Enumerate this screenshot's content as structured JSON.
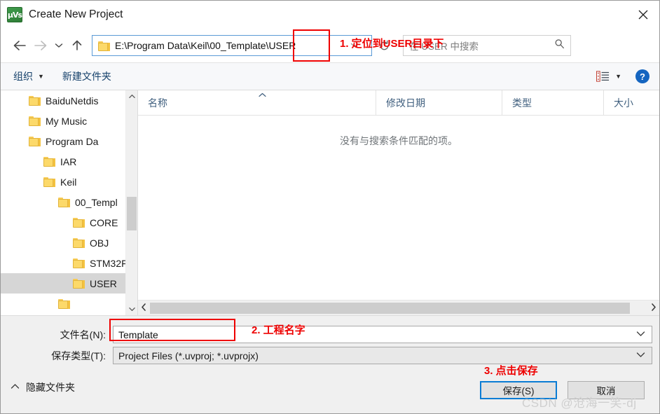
{
  "window": {
    "title": "Create New Project",
    "app_icon": "keil-uvision-icon",
    "close_label": "×"
  },
  "navbar": {
    "back_icon": "back-arrow-icon",
    "forward_icon": "forward-arrow-icon",
    "recent_icon": "recent-locations-chevron-icon",
    "up_icon": "up-arrow-icon",
    "address_path": "E:\\Program Data\\Keil\\00_Template\\USER",
    "address_folder_icon": "folder-icon",
    "address_chevron_icon": "chevron-down-icon",
    "refresh_icon": "refresh-icon",
    "search_placeholder": "在 USER 中搜索",
    "search_icon": "search-icon"
  },
  "commandbar": {
    "organize_label": "组织",
    "organize_caret": "▼",
    "new_folder_label": "新建文件夹",
    "view_icon": "view-layout-icon",
    "view_caret": "▼",
    "help_label": "?"
  },
  "tree": {
    "items": [
      {
        "label": "BaiduNetdis",
        "depth": 1,
        "selected": false
      },
      {
        "label": "My Music",
        "depth": 1,
        "selected": false
      },
      {
        "label": "Program Da",
        "depth": 1,
        "selected": false
      },
      {
        "label": "IAR",
        "depth": 2,
        "selected": false
      },
      {
        "label": "Keil",
        "depth": 2,
        "selected": false
      },
      {
        "label": "00_Templ",
        "depth": 3,
        "selected": false
      },
      {
        "label": "CORE",
        "depth": 4,
        "selected": false
      },
      {
        "label": "OBJ",
        "depth": 4,
        "selected": false
      },
      {
        "label": "STM32F",
        "depth": 4,
        "selected": false
      },
      {
        "label": "USER",
        "depth": 4,
        "selected": true
      },
      {
        "label": "",
        "depth": 3,
        "selected": false
      }
    ],
    "scroll_up_icon": "scroll-up-arrow-icon",
    "scroll_down_icon": "scroll-down-arrow-icon"
  },
  "filelist": {
    "columns": [
      {
        "label": "名称",
        "key": "name"
      },
      {
        "label": "修改日期",
        "key": "date"
      },
      {
        "label": "类型",
        "key": "type"
      },
      {
        "label": "大小",
        "key": "size"
      }
    ],
    "sort_caret": "^",
    "rows": [],
    "empty_message": "没有与搜索条件匹配的项。",
    "hscroll_left_icon": "scroll-left-arrow-icon",
    "hscroll_right_icon": "scroll-right-arrow-icon"
  },
  "form": {
    "filename_label": "文件名(N):",
    "filename_value": "Template",
    "filename_caret": "⌄",
    "filetype_label": "保存类型(T):",
    "filetype_value": "Project Files (*.uvproj; *.uvprojx)",
    "filetype_caret": "⌄",
    "hide_folders_label": "隐藏文件夹",
    "hide_folders_caret": "⌃",
    "save_label": "保存(S)",
    "cancel_label": "取消"
  },
  "annotations": [
    {
      "id": "annot1",
      "text": "1. 定位到USER目录下"
    },
    {
      "id": "annot2",
      "text": "2. 工程名字"
    },
    {
      "id": "annot3",
      "text": "3. 点击保存"
    }
  ],
  "watermark": {
    "text": "CSDN @沧海一笑-dj"
  },
  "colors": {
    "annotation_red": "#ee0000",
    "accent_blue": "#0a7cd4",
    "folder_yellow": "#fcd96a",
    "selection_gray": "#d6d6d6"
  }
}
